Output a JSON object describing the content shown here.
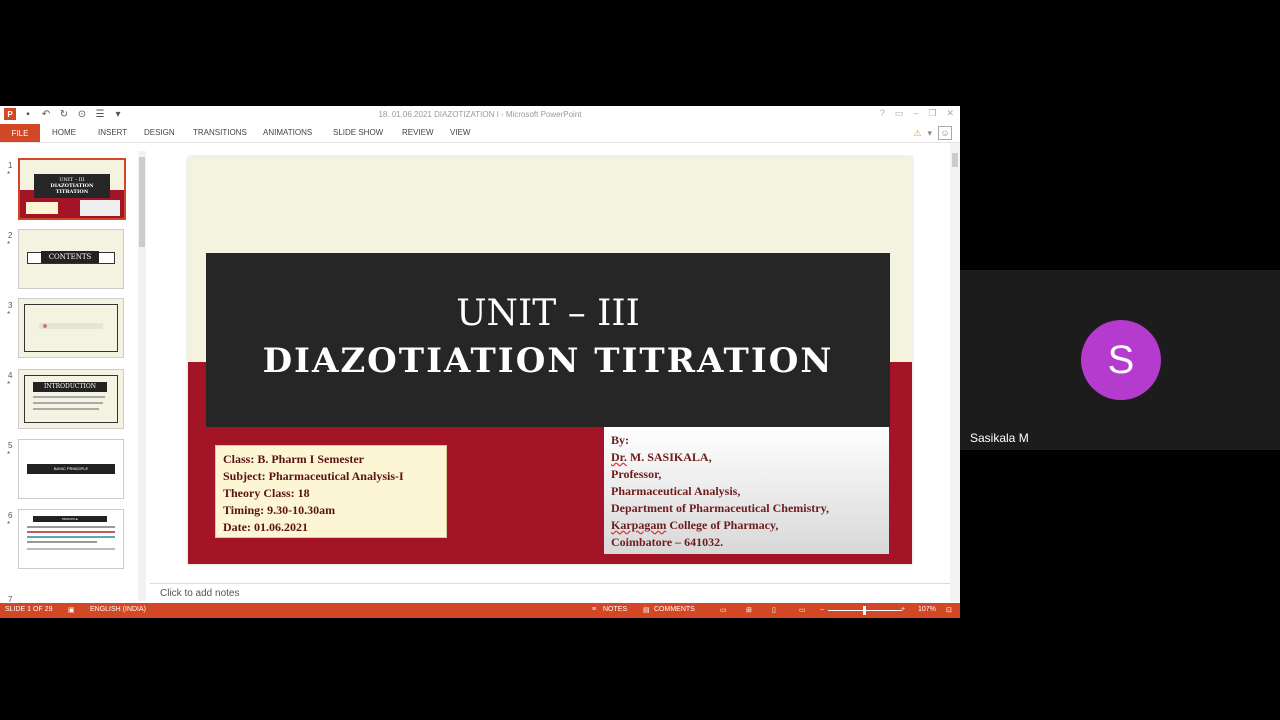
{
  "window": {
    "title": "18. 01.06.2021 DIAZOTIZATION I - Microsoft PowerPoint",
    "logo_letter": "P",
    "controls": [
      "?",
      "▭",
      "–",
      "❐",
      "✕"
    ]
  },
  "ribbon": {
    "file": "FILE",
    "tabs": [
      "HOME",
      "INSERT",
      "DESIGN",
      "TRANSITIONS",
      "ANIMATIONS",
      "SLIDE SHOW",
      "REVIEW",
      "VIEW"
    ]
  },
  "thumbnails": {
    "numbers": [
      "1",
      "2",
      "3",
      "4",
      "5",
      "6",
      "7"
    ],
    "star": "*",
    "slide1_title": "UNIT – III",
    "slide1_sub": "DIAZOTIATION TITRATION",
    "slide2_title": "CONTENTS",
    "slide4_title": "INTRODUCTION",
    "slide5_title": "BASIC PRINCIPLE",
    "slide6_title": "PRINCIPLE"
  },
  "slide": {
    "unit": "UNIT – III",
    "title": "DIAZOTIATION TITRATION",
    "left_box": [
      "Class: B. Pharm I Semester",
      "Subject: Pharmaceutical Analysis-I",
      "Theory Class: 18",
      "Timing: 9.30-10.30am",
      "Date: 01.06.2021"
    ],
    "right_box": {
      "by": "By:",
      "dr_prefix": "Dr.",
      "name": " M. SASIKALA,",
      "role": "Professor,",
      "dept1": "Pharmaceutical Analysis,",
      "dept2": "Department of Pharmaceutical Chemistry,",
      "college_prefix": "Karpagam",
      "college_rest": " College of Pharmacy,",
      "city": "Coimbatore – 641032."
    }
  },
  "notes_placeholder": "Click to add notes",
  "status": {
    "slide": "SLIDE 1 OF 29",
    "language": "ENGLISH (INDIA)",
    "notes": "NOTES",
    "comments": "COMMENTS",
    "zoom": "107%"
  },
  "participant": {
    "initial": "S",
    "name": "Sasikala M",
    "avatar_color": "#b53bcf"
  },
  "colors": {
    "accent": "#d24726",
    "slide_red": "#a31427",
    "slide_dark": "#262626",
    "slide_cream": "#f4f3df"
  }
}
